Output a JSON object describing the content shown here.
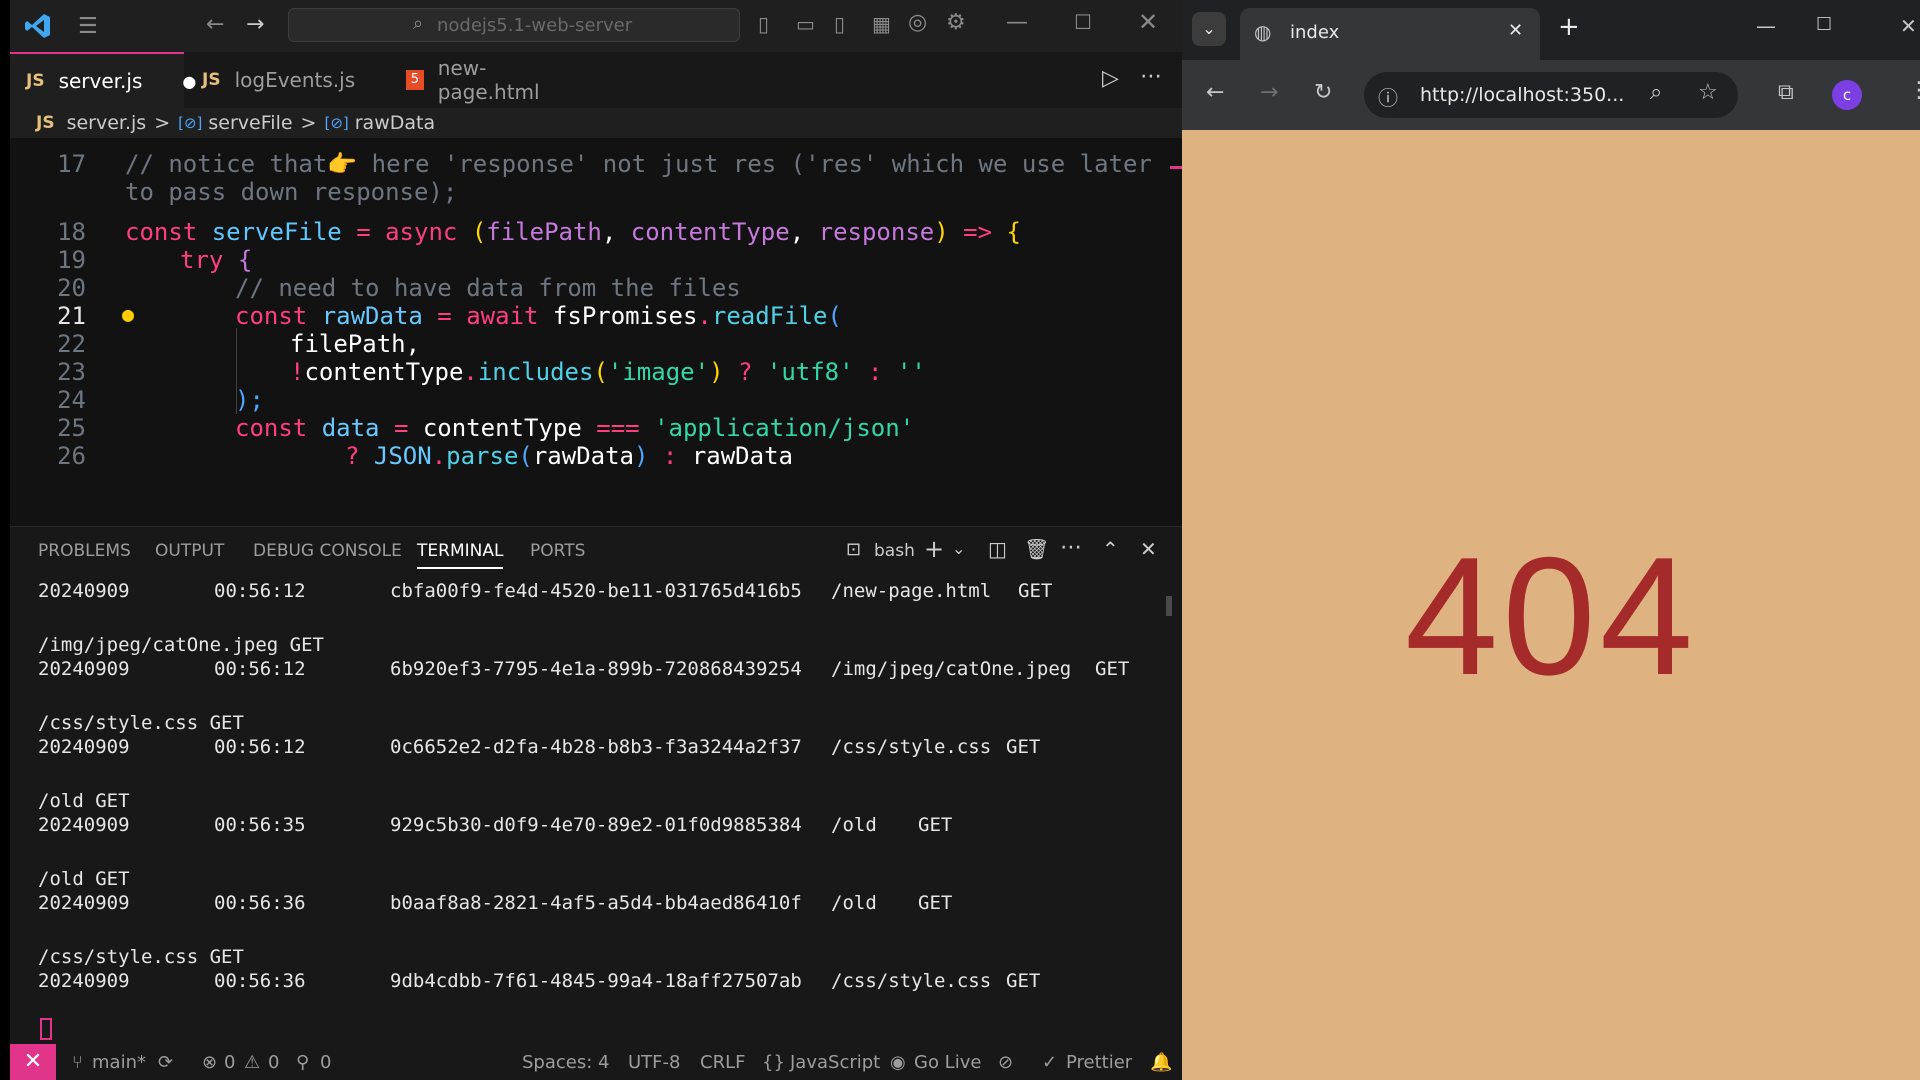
{
  "vscode": {
    "search_placeholder": "nodejs5.1-web-server",
    "tabs": [
      {
        "badge": "JS",
        "label": "server.js",
        "dirty": "●"
      },
      {
        "badge": "JS",
        "label": "logEvents.js"
      },
      {
        "badge": "5",
        "label": "new-page.html"
      }
    ],
    "breadcrumb": {
      "file": "server.js",
      "sep": ">",
      "item1": "serveFile",
      "item2": "rawData",
      "file_badge": "JS",
      "sym_badge": "[⊘]"
    },
    "line_numbers": [
      "17",
      "18",
      "19",
      "20",
      "21",
      "22",
      "23",
      "24",
      "25",
      "26"
    ],
    "code": {
      "l17a": "// notice that👉 here 'response' not just res ('res' which we use later",
      "l17b": "to pass down response);",
      "l18_const": "const",
      "l18_name": "serveFile",
      "l18_eq": " = ",
      "l18_async": "async",
      "l18_open": "(",
      "l18_p1": "filePath",
      "l18_c1": ", ",
      "l18_p2": "contentType",
      "l18_c2": ", ",
      "l18_p3": "response",
      "l18_close": ")",
      "l18_arrow": " => ",
      "l18_brace": "{",
      "l19_try": "try",
      "l19_brace": "{",
      "l20": "// need to have data from the files",
      "l21_const": "const",
      "l21_var": "rawData",
      "l21_eq": " = ",
      "l21_await": "await",
      "l21_obj": "fsPromises",
      "l21_dot": ".",
      "l21_fn": "readFile",
      "l21_paren": "(",
      "l22": "filePath,",
      "l23_not": "!",
      "l23_obj": "contentType",
      "l23_dot": ".",
      "l23_fn": "includes",
      "l23_open": "(",
      "l23_str": "'image'",
      "l23_close": ")",
      "l23_q": " ? ",
      "l23_s2": "'utf8'",
      "l23_colon": " : ",
      "l23_s3": "''",
      "l24": ");",
      "l25_const": "const",
      "l25_var": "data",
      "l25_eq": " = ",
      "l25_obj": "contentType",
      "l25_op": " === ",
      "l25_str": "'application/json'",
      "l26_q": "? ",
      "l26_obj": "JSON",
      "l26_dot": ".",
      "l26_fn": "parse",
      "l26_open": "(",
      "l26_arg": "rawData",
      "l26_close": ")",
      "l26_colon": " : ",
      "l26_tail": "rawData"
    },
    "panel_tabs": [
      "PROBLEMS",
      "OUTPUT",
      "DEBUG CONSOLE",
      "TERMINAL",
      "PORTS"
    ],
    "shell": "bash",
    "terminal": {
      "rows": [
        {
          "date": "20240909",
          "time": "00:56:12",
          "id": "cbfa00f9-fe4d-4520-be11-031765d416b5",
          "path": "/new-page.html",
          "method": "GET"
        },
        {
          "req": "/img/jpeg/catOne.jpeg GET"
        },
        {
          "date": "20240909",
          "time": "00:56:12",
          "id": "6b920ef3-7795-4e1a-899b-720868439254",
          "path": "/img/jpeg/catOne.jpeg",
          "method": "GET"
        },
        {
          "req": "/css/style.css GET"
        },
        {
          "date": "20240909",
          "time": "00:56:12",
          "id": "0c6652e2-d2fa-4b28-b8b3-f3a3244a2f37",
          "path": "/css/style.css",
          "method": "GET"
        },
        {
          "req": "/old GET"
        },
        {
          "date": "20240909",
          "time": "00:56:35",
          "id": "929c5b30-d0f9-4e70-89e2-01f0d9885384",
          "path": "/old",
          "method": "GET"
        },
        {
          "req": "/old GET"
        },
        {
          "date": "20240909",
          "time": "00:56:36",
          "id": "b0aaf8a8-2821-4af5-a5d4-bb4aed86410f",
          "path": "/old",
          "method": "GET"
        },
        {
          "req": "/css/style.css GET"
        },
        {
          "date": "20240909",
          "time": "00:56:36",
          "id": "9db4cdbb-7f61-4845-99a4-18aff27507ab",
          "path": "/css/style.css",
          "method": "GET"
        }
      ]
    },
    "status": {
      "remote": "✕",
      "branch": "main*",
      "errors": "0",
      "warnings": "0",
      "ports": "0",
      "spaces": "Spaces: 4",
      "encoding": "UTF-8",
      "eol": "CRLF",
      "language": "JavaScript",
      "golive": "Go Live",
      "prettier": "Prettier"
    }
  },
  "browser": {
    "tab_title": "index",
    "url": "http://localhost:350...",
    "profile": "c",
    "page_text": "404"
  },
  "colors": {
    "accent": "#e0358b",
    "page_bg": "#dfb381",
    "error_text": "#a52a2a"
  }
}
